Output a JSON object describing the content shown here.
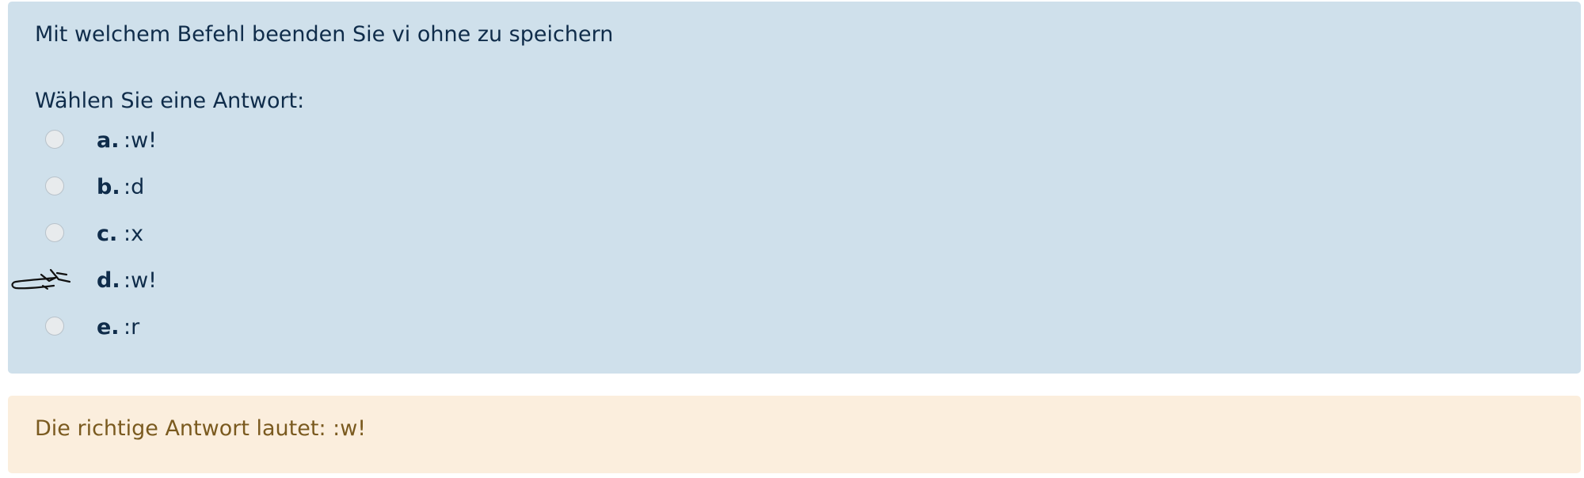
{
  "question": {
    "text": "Mit welchem Befehl beenden Sie vi ohne zu speichern",
    "prompt": "Wählen Sie eine Antwort:",
    "options": [
      {
        "letter": "a.",
        "text": ":w!",
        "selected": false
      },
      {
        "letter": "b.",
        "text": ":d",
        "selected": false
      },
      {
        "letter": "c.",
        "text": ":x",
        "selected": false
      },
      {
        "letter": "d.",
        "text": ":w!",
        "selected": true
      },
      {
        "letter": "e.",
        "text": ":r",
        "selected": false
      }
    ]
  },
  "feedback": {
    "text": "Die richtige Antwort lautet: :w!"
  },
  "colors": {
    "question_bg": "#cfe0eb",
    "feedback_bg": "#fbeedd",
    "text": "#0f2c4a",
    "feedback_text": "#7a5a1f"
  }
}
